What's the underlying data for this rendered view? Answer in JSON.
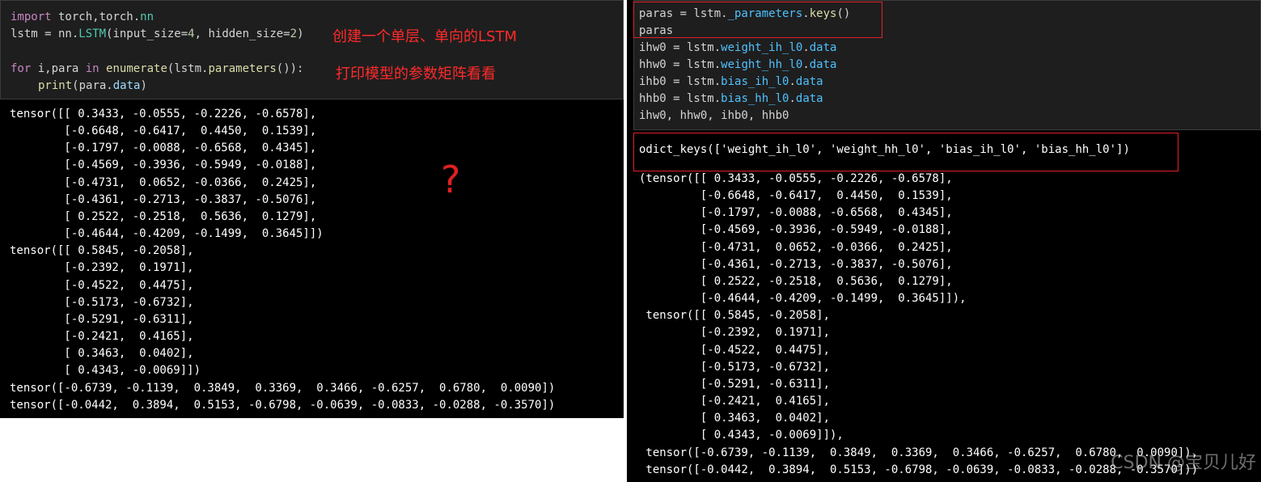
{
  "left": {
    "code": {
      "line1": {
        "kw": "import",
        "rest": " torch,torch.",
        "mod": "nn"
      },
      "line2": {
        "a": "lstm = nn.",
        "cls": "LSTM",
        "b": "(input_size=",
        "n1": "4",
        "c": ", hidden_size=",
        "n2": "2",
        "d": ")"
      },
      "line4": {
        "kw": "for",
        "a": " i,para ",
        "kw2": "in",
        "sp": " ",
        "fn": "enumerate",
        "b": "(lstm.",
        "fn2": "parameters",
        "c": "()):"
      },
      "line5": {
        "fn": "print",
        "a": "(para.",
        "attr": "data",
        "b": ")"
      }
    },
    "annotation_1": "创建一个单层、单向的LSTM",
    "annotation_2": "打印模型的参数矩阵看看",
    "question_mark": "?",
    "output": "tensor([[ 0.3433, -0.0555, -0.2226, -0.6578],\n        [-0.6648, -0.6417,  0.4450,  0.1539],\n        [-0.1797, -0.0088, -0.6568,  0.4345],\n        [-0.4569, -0.3936, -0.5949, -0.0188],\n        [-0.4731,  0.0652, -0.0366,  0.2425],\n        [-0.4361, -0.2713, -0.3837, -0.5076],\n        [ 0.2522, -0.2518,  0.5636,  0.1279],\n        [-0.4644, -0.4209, -0.1499,  0.3645]])\ntensor([[ 0.5845, -0.2058],\n        [-0.2392,  0.1971],\n        [-0.4522,  0.4475],\n        [-0.5173, -0.6732],\n        [-0.5291, -0.6311],\n        [-0.2421,  0.4165],\n        [ 0.3463,  0.0402],\n        [ 0.4343, -0.0069]])\ntensor([-0.6739, -0.1139,  0.3849,  0.3369,  0.3466, -0.6257,  0.6780,  0.0090])\ntensor([-0.0442,  0.3894,  0.5153, -0.6798, -0.0639, -0.0833, -0.0288, -0.3570])"
  },
  "right": {
    "code": {
      "line1": {
        "a": "paras = lstm.",
        "attr": "_parameters",
        "dot": ".",
        "fn": "keys",
        "b": "()"
      },
      "line2": "paras",
      "line3": {
        "a": "ihw0 = lstm.",
        "attr": "weight_ih_l0",
        "dot": ".",
        "attr2": "data"
      },
      "line4": {
        "a": "hhw0 = lstm.",
        "attr": "weight_hh_l0",
        "dot": ".",
        "attr2": "data"
      },
      "line5": {
        "a": "ihb0 = lstm.",
        "attr": "bias_ih_l0",
        "dot": ".",
        "attr2": "data"
      },
      "line6": {
        "a": "hhb0 = lstm.",
        "attr": "bias_hh_l0",
        "dot": ".",
        "attr2": "data"
      },
      "line7": "ihw0, hhw0, ihb0, hhb0"
    },
    "odict_output": "odict_keys(['weight_ih_l0', 'weight_hh_l0', 'bias_ih_l0', 'bias_hh_l0'])",
    "output": "(tensor([[ 0.3433, -0.0555, -0.2226, -0.6578],\n         [-0.6648, -0.6417,  0.4450,  0.1539],\n         [-0.1797, -0.0088, -0.6568,  0.4345],\n         [-0.4569, -0.3936, -0.5949, -0.0188],\n         [-0.4731,  0.0652, -0.0366,  0.2425],\n         [-0.4361, -0.2713, -0.3837, -0.5076],\n         [ 0.2522, -0.2518,  0.5636,  0.1279],\n         [-0.4644, -0.4209, -0.1499,  0.3645]]),\n tensor([[ 0.5845, -0.2058],\n         [-0.2392,  0.1971],\n         [-0.4522,  0.4475],\n         [-0.5173, -0.6732],\n         [-0.5291, -0.6311],\n         [-0.2421,  0.4165],\n         [ 0.3463,  0.0402],\n         [ 0.4343, -0.0069]]),\n tensor([-0.6739, -0.1139,  0.3849,  0.3369,  0.3466, -0.6257,  0.6780,  0.0090]),\n tensor([-0.0442,  0.3894,  0.5153, -0.6798, -0.0639, -0.0833, -0.0288, -0.3570]))",
    "watermark": "CSDN @宝贝儿好"
  }
}
